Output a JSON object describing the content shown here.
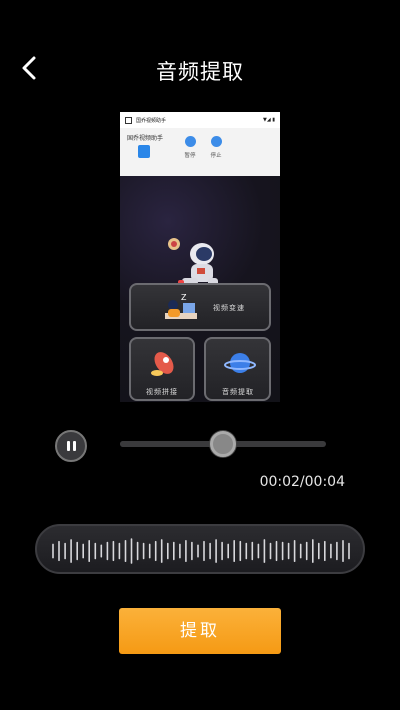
{
  "header": {
    "title": "音频提取",
    "back_icon": "chevron-left-icon"
  },
  "preview": {
    "status_text": "国乔视频助手",
    "signal_text": "▼◢ ▮",
    "notification": {
      "app_name": "国乔视频助手",
      "pause_label": "暂停",
      "stop_label": "停止"
    },
    "cards": {
      "speed_label": "视频变速",
      "splice_label": "视频拼接",
      "audio_label": "音频提取"
    }
  },
  "player": {
    "pause_icon": "pause-icon",
    "progress": 0.5,
    "time_text": "00:02/00:04"
  },
  "waveform": {
    "bars": [
      0.4,
      0.7,
      0.5,
      0.9,
      0.6,
      0.4,
      0.8,
      0.5,
      0.3,
      0.6,
      0.7,
      0.5,
      0.8,
      1.0,
      0.6,
      0.5,
      0.4,
      0.7,
      0.9,
      0.5,
      0.6,
      0.4,
      0.8,
      0.6,
      0.3,
      0.7,
      0.5,
      0.9,
      0.6,
      0.4,
      0.8,
      0.7,
      0.5,
      0.6,
      0.4,
      0.9,
      0.5,
      0.7,
      0.6,
      0.5,
      0.8,
      0.4,
      0.6,
      0.9,
      0.5,
      0.7,
      0.4,
      0.6,
      0.8,
      0.5
    ]
  },
  "actions": {
    "extract_label": "提取"
  },
  "colors": {
    "accent": "#f7a41f",
    "background": "#000000"
  }
}
